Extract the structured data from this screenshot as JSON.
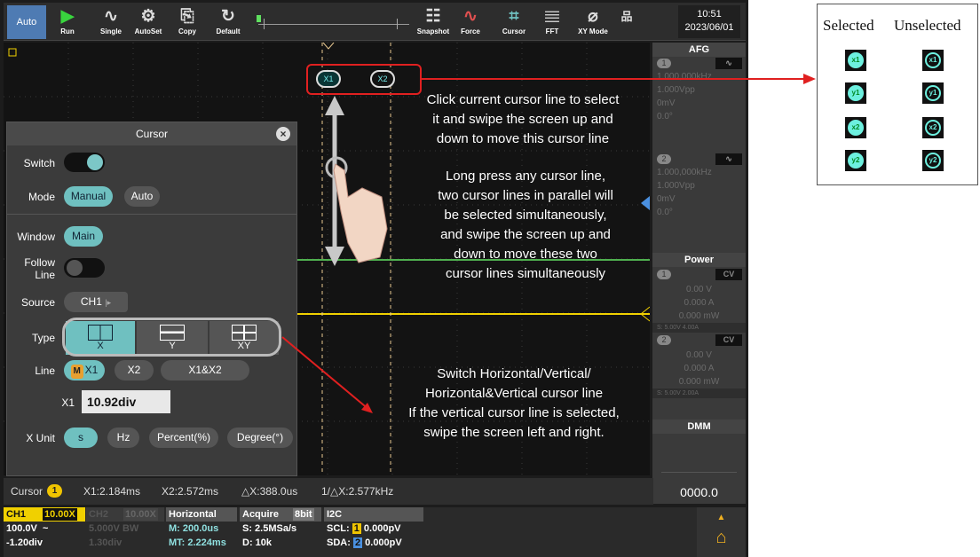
{
  "toolbar": {
    "auto": "Auto",
    "run": "Run",
    "single": "Single",
    "autoset": "AutoSet",
    "copy": "Copy",
    "default": "Default",
    "snapshot": "Snapshot",
    "force": "Force",
    "cursor": "Cursor",
    "fft": "FFT",
    "xymode": "XY Mode",
    "time": "10:51",
    "date": "2023/06/01"
  },
  "afg": {
    "title": "AFG",
    "ch1": "1",
    "ch1_freq": "1.000,000kHz",
    "ch1_amp": "1.000Vpp",
    "ch1_offset": "0mV",
    "ch1_phase": "0.0°",
    "ch2": "2",
    "ch2_freq": "1.000,000kHz",
    "ch2_amp": "1.000Vpp",
    "ch2_offset": "0mV",
    "ch2_phase": "0.0°"
  },
  "power": {
    "title": "Power",
    "ch1": "1",
    "ch1_mode": "CV",
    "ch1_v": "0.00 V",
    "ch1_a": "0.000 A",
    "ch1_w": "0.000 mW",
    "ch1_set": "S: 5.00V 4.00A",
    "ch2": "2",
    "ch2_mode": "CV",
    "ch2_v": "0.00 V",
    "ch2_a": "0.000 A",
    "ch2_w": "0.000 mW",
    "ch2_set": "S: 5.00V 2.00A"
  },
  "dmm": {
    "title": "DMM",
    "value": "0000.0"
  },
  "cursor_panel": {
    "title": "Cursor",
    "switch_label": "Switch",
    "mode_label": "Mode",
    "mode_manual": "Manual",
    "mode_auto": "Auto",
    "window_label": "Window",
    "window_main": "Main",
    "follow_label_1": "Follow",
    "follow_label_2": "Line",
    "source_label": "Source",
    "source_value": "CH1",
    "type_label": "Type",
    "type_x": "X",
    "type_y": "Y",
    "type_xy": "XY",
    "line_label": "Line",
    "line_m": "M",
    "line_x1": "X1",
    "line_x2": "X2",
    "line_x1x2": "X1&X2",
    "x1_label": "X1",
    "x1_value": "10.92div",
    "xunit_label": "X Unit",
    "xunit_s": "s",
    "xunit_hz": "Hz",
    "xunit_percent": "Percent(%)",
    "xunit_degree": "Degree(°)"
  },
  "cursor_status": {
    "label": "Cursor",
    "ch": "1",
    "x1": "X1:2.184ms",
    "x2": "X2:2.572ms",
    "dx": "△X:388.0us",
    "inv": "1/△X:2.577kHz"
  },
  "bottom": {
    "ch1": "CH1",
    "ch1_probe": "10.00X",
    "ch1_scale": "100.0V",
    "ch1_coupling": "~",
    "ch1_pos": "-1.20div",
    "ch2": "CH2",
    "ch2_probe": "10.00X",
    "ch2_scale": "5.000V",
    "ch2_bw": "BW",
    "ch2_pos": "1.30div",
    "horizontal": "Horizontal",
    "h_main": "M: 200.0us",
    "h_mt": "MT: 2.224ms",
    "acquire": "Acquire",
    "acq_bits": "8bit",
    "acq_rate": "S: 2.5MSa/s",
    "acq_depth": "D: 10k",
    "i2c": "I2C",
    "scl_label": "SCL:",
    "scl_ch": "1",
    "scl_val": "0.000pV",
    "sda_label": "SDA:",
    "sda_ch": "2",
    "sda_val": "0.000pV"
  },
  "annotations": {
    "a1_l1": "Click current cursor line to select",
    "a1_l2": "it and swipe the screen up and",
    "a1_l3": "down to move this cursor line",
    "a2_l1": "Long press any cursor line,",
    "a2_l2": "two cursor lines in parallel will",
    "a2_l3": "be selected simultaneously,",
    "a2_l4": "and swipe the screen up and",
    "a2_l5": "down to move these two",
    "a2_l6": "cursor lines simultaneously",
    "a3_l1": "Switch Horizontal/Vertical/",
    "a3_l2": "Horizontal&Vertical cursor line",
    "a3_l3": "If the vertical cursor line is selected,",
    "a3_l4": "swipe the screen left and right.",
    "cx1": "X1",
    "cx2": "X2"
  },
  "legend": {
    "selected": "Selected",
    "unselected": "Unselected",
    "x1": "x1",
    "y1": "y1",
    "x2": "x2",
    "y2": "y2"
  },
  "colors": {
    "ch1_trace": "#f0d000",
    "ch2_trace": "#4fb04f",
    "accent": "#6fc0c0",
    "annotation_red": "#e02020"
  }
}
